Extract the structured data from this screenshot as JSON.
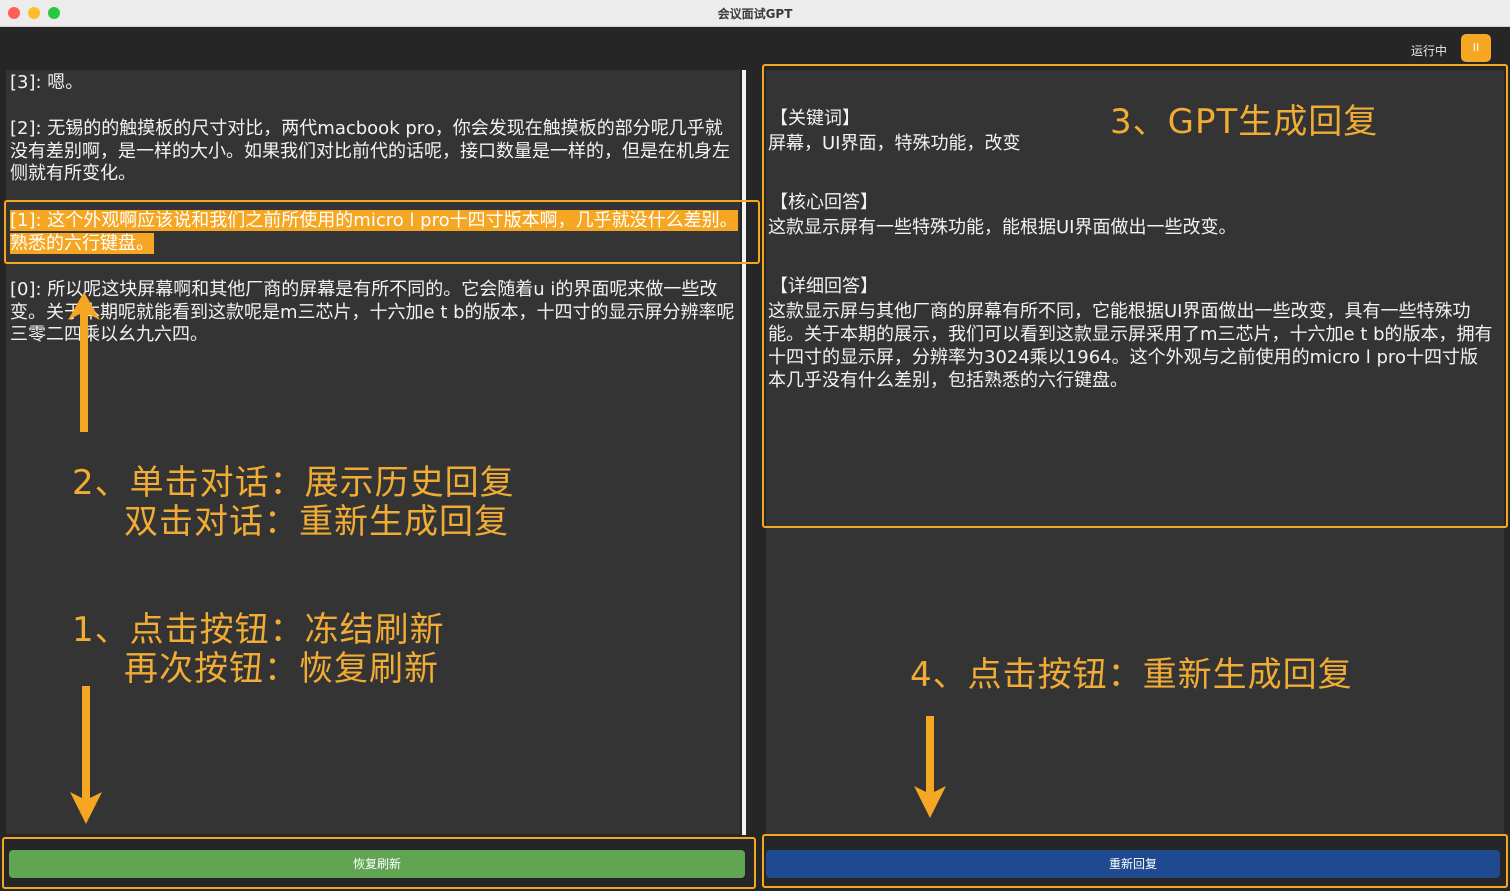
{
  "window": {
    "title": "会议面试GPT"
  },
  "status": {
    "text": "运行中",
    "pause_icon": "pause-icon",
    "pause_glyph": "II"
  },
  "transcript": [
    {
      "text": "[3]: 嗯。"
    },
    {
      "text": "[2]: 无锡的的触摸板的尺寸对比，两代macbook pro，你会发现在触摸板的部分呢几乎就没有差别啊，是一样的大小。如果我们对比前代的话呢，接口数量是一样的，但是在机身左侧就有所变化。"
    },
    {
      "text": "[1]: 这个外观啊应该说和我们之前所使用的micro l pro十四寸版本啊，几乎就没什么差别。熟悉的六行键盘。",
      "selected": true
    },
    {
      "text": "[0]: 所以呢这块屏幕啊和其他厂商的屏幕是有所不同的。它会随着u i的界面呢来做一些改变。关于本期呢就能看到这款呢是m三芯片，十六加e t b的版本，十四寸的显示屏分辨率呢三零二四乘以幺九六四。"
    }
  ],
  "response": {
    "keywords_title": "【关键词】",
    "keywords": "屏幕，UI界面，特殊功能，改变",
    "core_title": "【核心回答】",
    "core": "这款显示屏有一些特殊功能，能根据UI界面做出一些改变。",
    "detail_title": "【详细回答】",
    "detail": "这款显示屏与其他厂商的屏幕有所不同，它能根据UI界面做出一些改变，具有一些特殊功能。关于本期的展示，我们可以看到这款显示屏采用了m三芯片，十六加e t b的版本，拥有十四寸的显示屏，分辨率为3024乘以1964。这个外观与之前使用的micro l pro十四寸版本几乎没有什么差别，包括熟悉的六行键盘。"
  },
  "buttons": {
    "resume": "恢复刷新",
    "regenerate": "重新回复"
  },
  "annotations": {
    "a1_line1": "1、点击按钮：冻结刷新",
    "a1_line2": "再次按钮：恢复刷新",
    "a2_line1": "2、单击对话：展示历史回复",
    "a2_line2": "双击对话：重新生成回复",
    "a3": "3、GPT生成回复",
    "a4": "4、点击按钮：重新生成回复"
  },
  "colors": {
    "accent": "#f5a623",
    "resume_button": "#61a554",
    "regenerate_button": "#1f4a90",
    "panel": "#343434",
    "background": "#262626"
  }
}
